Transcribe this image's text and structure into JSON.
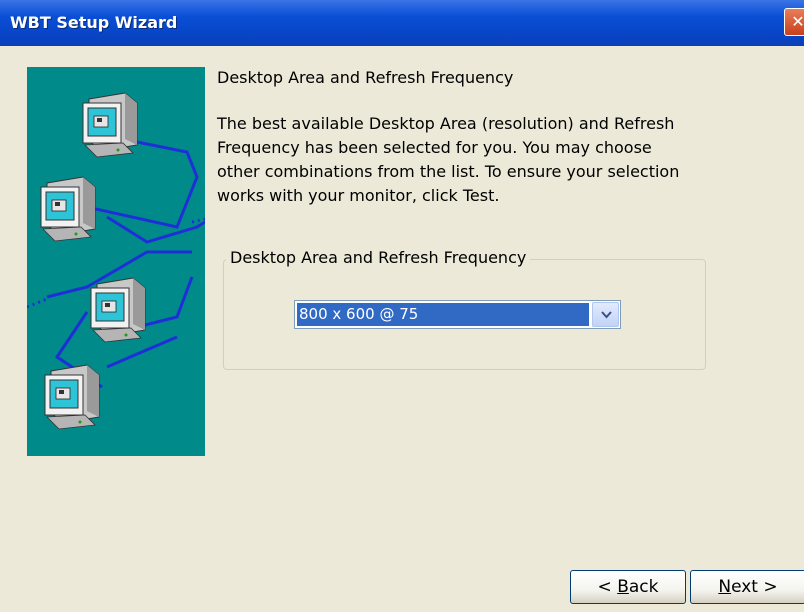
{
  "window": {
    "title": "WBT Setup Wizard",
    "close_glyph": "✕"
  },
  "main": {
    "heading": "Desktop Area and Refresh Frequency",
    "description": "The best available Desktop Area (resolution) and Refresh Frequency has been selected for you.  You may choose other combinations from the list.  To ensure your selection works with your monitor, click Test.",
    "group_label": "Desktop Area and Refresh Frequency",
    "resolution_value": "800 x 600 @ 75"
  },
  "buttons": {
    "back_underline": "B",
    "back_rest": "ack",
    "next_underline": "N",
    "next_rest": "ext >"
  },
  "colors": {
    "title_bar": "#0a4fd6",
    "illustration_bg": "#008a8a",
    "selection": "#316ac5",
    "window_bg": "#ece9d8"
  }
}
